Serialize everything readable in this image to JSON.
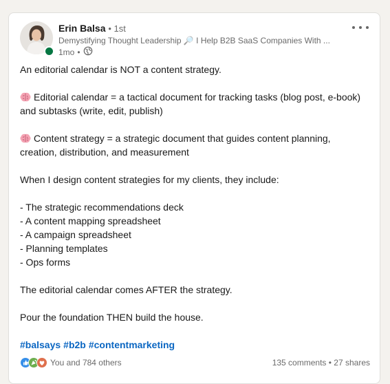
{
  "post": {
    "author": {
      "name": "Erin Balsa",
      "degree": "1st",
      "headline": "Demystifying Thought Leadership 🔎 I Help B2B SaaS Companies With ...",
      "time": "1mo"
    },
    "lines": {
      "l1": "An editorial calendar is NOT a content strategy.",
      "l2": "Editorial calendar = a tactical document for tracking tasks (blog post, e-book) and subtasks (write, edit, publish)",
      "l3": "Content strategy = a strategic document that guides content planning, creation, distribution, and measurement",
      "l4": "When I design content strategies for my clients, they include:",
      "b1": "- The strategic recommendations deck",
      "b2": "- A content mapping spreadsheet",
      "b3": "- A campaign spreadsheet",
      "b4": "- Planning templates",
      "b5": "- Ops forms",
      "l5": "The editorial calendar comes AFTER the strategy.",
      "l6": "Pour the foundation THEN build the house."
    },
    "hashtags": [
      "#balsays",
      "#b2b",
      "#contentmarketing"
    ],
    "social": {
      "reactions_text": "You and 784 others",
      "comments": "135 comments",
      "shares": "27 shares",
      "separator": "•"
    }
  },
  "colors": {
    "hashtag": "#0a66c2",
    "presence": "#057642",
    "like": "#378fe9",
    "celebrate": "#44712e",
    "love": "#df704d"
  },
  "icons": [
    "avatar",
    "presence-dot",
    "globe-icon",
    "more-icon",
    "brain-icon",
    "like-icon",
    "celebrate-icon",
    "love-icon"
  ]
}
